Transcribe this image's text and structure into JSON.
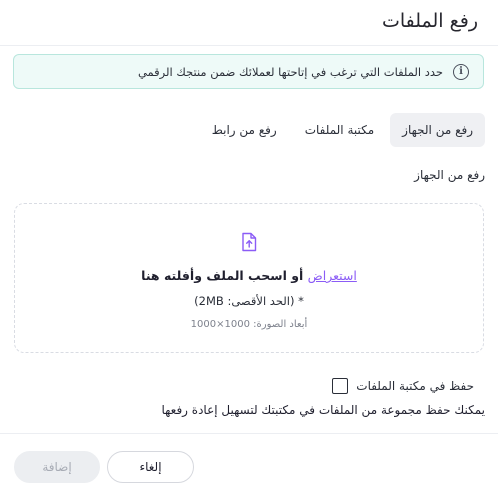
{
  "dialog": {
    "title": "رفع الملفات",
    "info": "حدد الملفات التي ترغب في إتاحتها لعملائك ضمن منتجك الرقمي"
  },
  "tabs": [
    {
      "label": "رفع من الجهاز",
      "active": true
    },
    {
      "label": "مكتبة الملفات",
      "active": false
    },
    {
      "label": "رفع من رابط",
      "active": false
    }
  ],
  "section_label": "رفع من الجهاز",
  "dropzone": {
    "browse_label": "استعراض",
    "drop_text": " أو اسحب الملف وأفلته هنا",
    "max_size": "* (الحد الأقصى: 2MB)",
    "dimensions": "أبعاد الصورة: 1000×1000",
    "icon": "upload-file-icon"
  },
  "save_option": {
    "label": "حفظ في مكتبة الملفات",
    "checked": false,
    "hint": "يمكنك حفظ مجموعة من الملفات في مكتبتك لتسهيل إعادة رفعها"
  },
  "footer": {
    "cancel_label": "إلغاء",
    "add_label": "إضافة"
  },
  "colors": {
    "accent": "#8b5cf6",
    "info_bg": "#eefaf8",
    "info_border": "#b8e6dd"
  }
}
